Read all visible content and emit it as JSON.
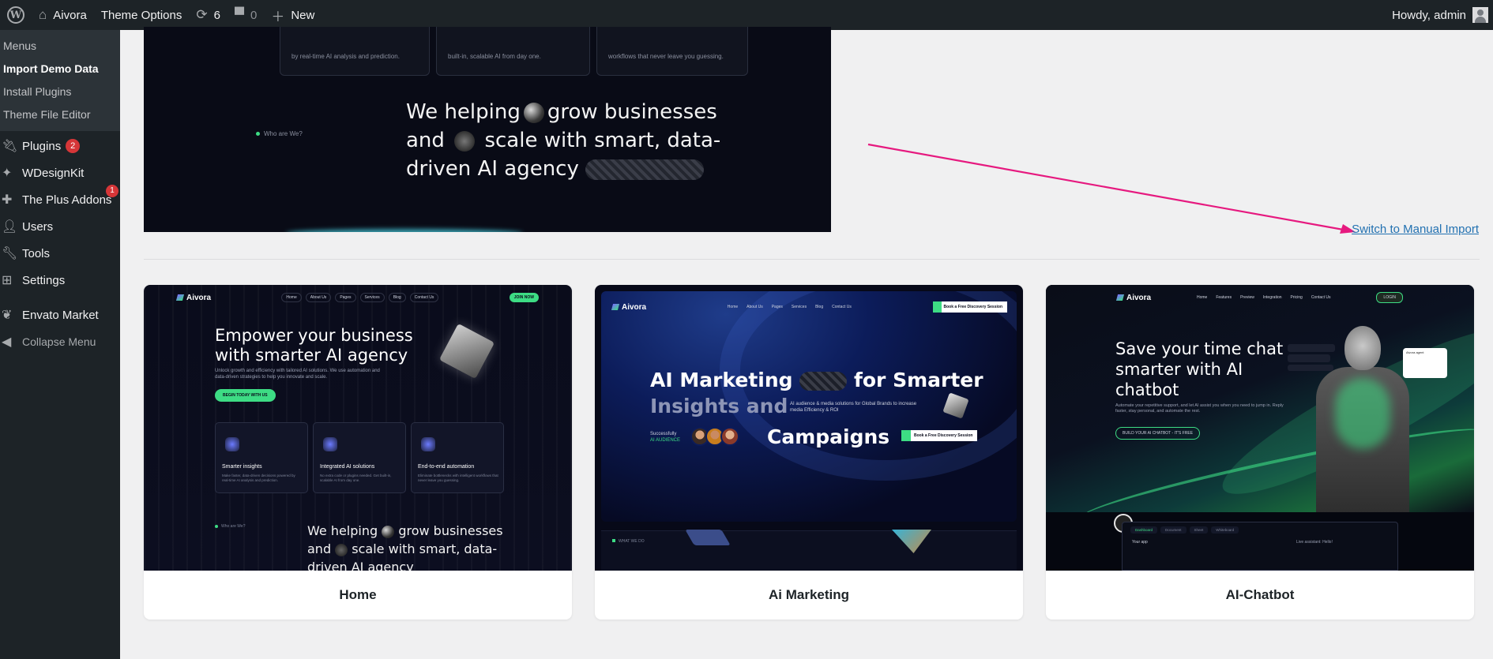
{
  "admin_bar": {
    "site_name": "Aivora",
    "theme_options": "Theme Options",
    "updates_count": "6",
    "comments_count": "0",
    "new_label": "New",
    "greeting": "Howdy, admin"
  },
  "sidebar": {
    "submenu": [
      {
        "label": "Menus"
      },
      {
        "label": "Import Demo Data"
      },
      {
        "label": "Install Plugins"
      },
      {
        "label": "Theme File Editor"
      }
    ],
    "items": [
      {
        "label": "Plugins",
        "badge": "2",
        "icon": "plugin-icon"
      },
      {
        "label": "WDesignKit",
        "icon": "wdesignkit-icon"
      },
      {
        "label": "The Plus Addons",
        "badge": "1",
        "icon": "plus-addons-icon"
      },
      {
        "label": "Users",
        "icon": "users-icon"
      },
      {
        "label": "Tools",
        "icon": "wrench-icon"
      },
      {
        "label": "Settings",
        "icon": "settings-icon"
      },
      {
        "label": "Envato Market",
        "icon": "envato-icon"
      }
    ],
    "collapse_label": "Collapse Menu"
  },
  "top_preview": {
    "card1_text": "by real-time AI analysis and prediction.",
    "card2_text": "built-in, scalable AI from day one.",
    "card3_text": "workflows that never leave you guessing.",
    "who_label": "Who are We?",
    "hero_line1a": "We helping",
    "hero_line1b": "grow businesses",
    "hero_line2a": "and",
    "hero_line2b": "scale with smart, data-",
    "hero_line3": "driven AI agency"
  },
  "manual_import_link": "Switch to Manual Import",
  "accent_color": "#e6197f",
  "demos": [
    {
      "caption": "Home",
      "logo": "Aivora",
      "nav": [
        "Home",
        "About Us",
        "Pages",
        "Services",
        "Blog",
        "Contact Us"
      ],
      "cta": "JOIN NOW",
      "headline": "Empower your business with smarter AI agency",
      "sub": "Unlock growth and efficiency with tailored AI solutions. We use automation and data-driven strategies to help you innovate and scale.",
      "button": "BEGIN TODAY WITH US",
      "features": [
        {
          "title": "Smarter insights",
          "text": "Make faster, data-driven decisions powered by real-time AI analysis and prediction."
        },
        {
          "title": "Integrated AI solutions",
          "text": "No extra code or plugins needed. Get built-in, scalable AI from day one."
        },
        {
          "title": "End-to-end automation",
          "text": "Eliminate bottlenecks with intelligent workflows that never leave you guessing."
        }
      ],
      "who": "Who are We?",
      "hero_line1a": "We helping",
      "hero_line1b": "grow businesses",
      "hero_line2a": "and",
      "hero_line2b": "scale with smart, data-",
      "hero_line3": "driven AI agency"
    },
    {
      "caption": "Ai Marketing",
      "logo": "Aivora",
      "nav": [
        "Home",
        "About Us",
        "Pages",
        "Services",
        "Blog",
        "Contact Us"
      ],
      "cta": "Book a Free Discovery Session",
      "line1": "AI Marketing",
      "line1b": "for Smarter",
      "line2": "Insights and",
      "aud": "AI audience & media solutions for Global Brands to increase media Efficiency & ROI",
      "succ1": "Successfully",
      "succ2": "AI AUDIENCE",
      "line3": "Campaigns",
      "cta2": "Book a Free Discovery Session",
      "what": "WHAT WE DO"
    },
    {
      "caption": "AI-Chatbot",
      "logo": "Aivora",
      "nav": [
        "Home",
        "Features",
        "Preview",
        "Integration",
        "Pricing",
        "Contact Us"
      ],
      "login": "LOGIN",
      "headline": "Save your time chat smarter with AI chatbot",
      "sub": "Automate your repetitive support, and let AI assist you when you need to jump in. Reply faster, stay personal, and automate the rest.",
      "button": "BUILD YOUR AI CHATBOT - IT'S FREE",
      "chat_agent": "Aivora agent",
      "dash_tabs": [
        "Dashboard",
        "Document",
        "Sheet",
        "Whiteboard"
      ],
      "dash_row": "Your app",
      "dash_hello": "Live assistant: Hello!"
    }
  ]
}
